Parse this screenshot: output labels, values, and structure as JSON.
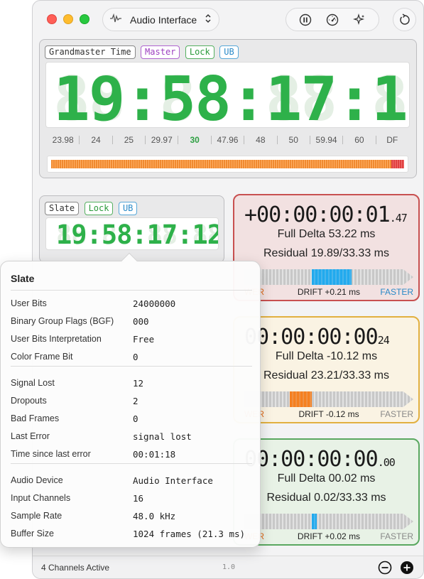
{
  "device": {
    "name": "Audio Interface"
  },
  "icons": {
    "waveform": "waveform-icon",
    "chevron": "chevron-updown-icon",
    "pause": "pause-icon",
    "gauge": "gauge-icon",
    "sparkle": "sparkle-icon",
    "reset": "reset-icon",
    "minus": "minus-circle-icon",
    "plus": "plus-circle-icon"
  },
  "main": {
    "tags": {
      "source": "Grandmaster Time",
      "role": "Master",
      "lock": "Lock",
      "ub": "UB"
    },
    "timecode": "19:58:17:11",
    "framerates": [
      "23.98",
      "24",
      "25",
      "29.97",
      "30",
      "47.96",
      "48",
      "50",
      "59.94",
      "60",
      "DF"
    ],
    "active_framerate": "30",
    "level": 1.0
  },
  "slate": {
    "tags": {
      "name": "Slate",
      "lock": "Lock",
      "ub": "UB"
    },
    "timecode": "19:58:17:12"
  },
  "cards": [
    {
      "timecode": "+00:00:00:01",
      "sub": ".47",
      "full_delta_label": "Full Delta",
      "full_delta": "53.22 ms",
      "residual_label": "Residual",
      "residual": "19.89/33.33 ms",
      "lower": "WER",
      "drift": "DRIFT +0.21 ms",
      "faster": "FASTER",
      "color": "#c85050",
      "bg": "#f2e1e1",
      "bar_color": "#22aaee",
      "drift_fill": 0.5,
      "faster_color": "#2a8ac8"
    },
    {
      "timecode": "00:00:00:00",
      "sub": "24",
      "full_delta_label": "Full Delta",
      "full_delta": "-10.12 ms",
      "residual_label": "Residual",
      "residual": "23.21/33.33 ms",
      "lower": "WER",
      "drift": "DRIFT -0.12 ms",
      "faster": "FASTER",
      "color": "#e2b040",
      "bg": "#faf3e3",
      "bar_color": "#f58020",
      "drift_fill": -0.28,
      "faster_color": "#888"
    },
    {
      "timecode": "00:00:00:00",
      "sub": ".00",
      "full_delta_label": "Full Delta",
      "full_delta": "00.02 ms",
      "residual_label": "Residual",
      "residual": "0.02/33.33 ms",
      "lower": "WER",
      "drift": "DRIFT +0.02 ms",
      "faster": "FASTER",
      "color": "#5aa860",
      "bg": "#e8f2e6",
      "bar_color": "#22aaee",
      "drift_fill": 0.04,
      "faster_color": "#888"
    }
  ],
  "popover": {
    "title": "Slate",
    "groups": [
      [
        {
          "k": "User Bits",
          "v": "24000000"
        },
        {
          "k": "Binary Group Flags (BGF)",
          "v": "000"
        },
        {
          "k": "User Bits Interpretation",
          "v": "Free"
        },
        {
          "k": "Color Frame Bit",
          "v": "0"
        }
      ],
      [
        {
          "k": "Signal Lost",
          "v": "12"
        },
        {
          "k": "Dropouts",
          "v": "2"
        },
        {
          "k": "Bad Frames",
          "v": "0"
        },
        {
          "k": "Last Error",
          "v": "signal lost"
        },
        {
          "k": "Time since last error",
          "v": "00:01:18"
        }
      ],
      [
        {
          "k": "Audio Device",
          "v": "Audio Interface"
        },
        {
          "k": "Input Channels",
          "v": "16"
        },
        {
          "k": "Sample Rate",
          "v": "48.0 kHz"
        },
        {
          "k": "Buffer Size",
          "v": "1024 frames (21.3 ms)"
        }
      ]
    ]
  },
  "footer": {
    "status": "4 Channels Active",
    "version": "1.0"
  }
}
